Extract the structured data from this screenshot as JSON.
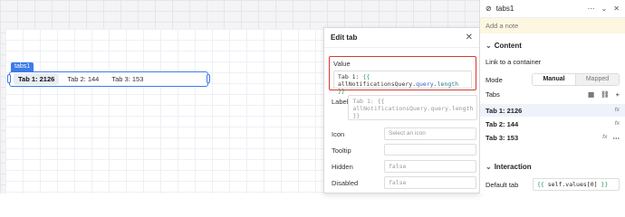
{
  "canvas": {
    "component_tag": "tabs1",
    "tabs": [
      {
        "label": "Tab 1: 2126",
        "active": true
      },
      {
        "label": "Tab 2: 144",
        "active": false
      },
      {
        "label": "Tab 3: 153",
        "active": false
      }
    ]
  },
  "popover": {
    "title": "Edit tab",
    "value_label": "Value",
    "value_prefix": "Tab 1: ",
    "value_open": "{{",
    "value_obj": "allNotificationsQuery",
    "value_dot1": ".",
    "value_prop1": "query",
    "value_dot2": ".",
    "value_prop2": "length",
    "value_close": " }}",
    "fields": [
      {
        "label": "Label",
        "value": "Tab 1: {{ allNotificationsQuery.query.length }}"
      },
      {
        "label": "Icon",
        "value": "Select an icon"
      },
      {
        "label": "Tooltip",
        "value": ""
      },
      {
        "label": "Hidden",
        "value": "false"
      },
      {
        "label": "Disabled",
        "value": "false"
      }
    ]
  },
  "inspector": {
    "component_name": "tabs1",
    "add_note": "Add a note",
    "content_section": "Content",
    "link_container": "Link to a container",
    "mode_label": "Mode",
    "mode_options": [
      "Manual",
      "Mapped"
    ],
    "tabs_label": "Tabs",
    "tab_items": [
      "Tab 1: 2126",
      "Tab 2: 144",
      "Tab 3: 153"
    ],
    "fx_label": "fx",
    "interaction_section": "Interaction",
    "default_tab_label": "Default tab",
    "default_tab_open": "{{",
    "default_tab_value": " self.values[0] ",
    "default_tab_close": "}}"
  },
  "colors": {
    "accent": "#3d7be8",
    "highlight_border": "#d6382b",
    "note_bg": "#fdf7e2"
  }
}
